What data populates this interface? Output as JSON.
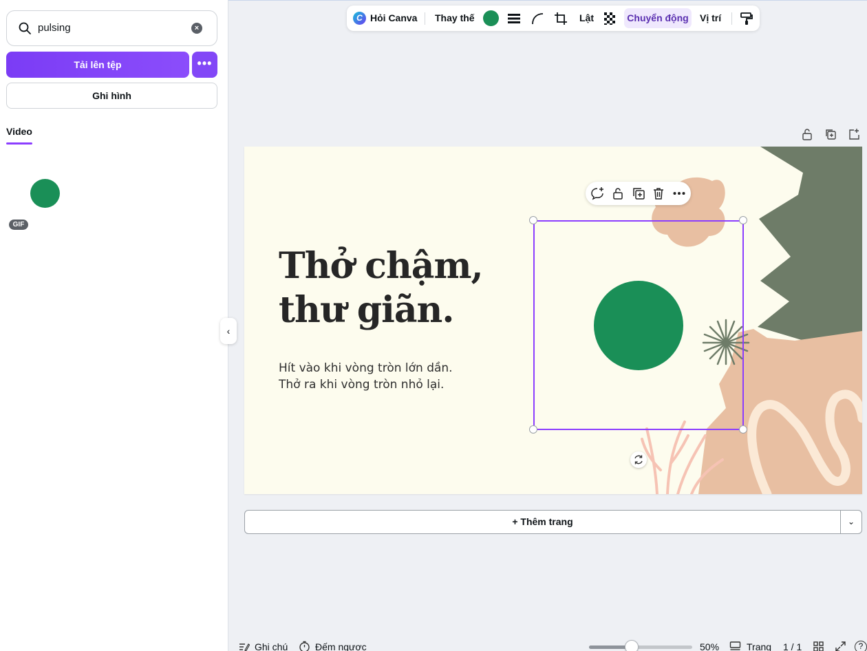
{
  "sidebar": {
    "search": {
      "value": "pulsing",
      "icon": "search-icon",
      "clear_icon": "clear-icon"
    },
    "upload_label": "Tải lên tệp",
    "more_label": "•••",
    "record_label": "Ghi hình",
    "tab_label": "Video",
    "result_badge": "GIF",
    "collapse_label": "‹"
  },
  "toolbar": {
    "ask_canva": "Hỏi Canva",
    "replace": "Thay thế",
    "flip": "Lật",
    "animate": "Chuyển động",
    "position": "Vị trí",
    "color": "#1a8f57"
  },
  "canvas": {
    "title_line1": "Thở chậm,",
    "title_line2": "thư giãn.",
    "body_line1": "Hít vào khi vòng tròn lớn dần.",
    "body_line2": "Thở ra khi vòng tròn nhỏ lại.",
    "circle_color": "#1a8f57",
    "background": "#fdfcee"
  },
  "add_page_label": "+ Thêm trang",
  "add_page_dd": "⌄",
  "bottom_bar": {
    "notes": "Ghi chú",
    "timer": "Đếm ngược",
    "zoom": "50%",
    "pages_label": "Trang",
    "page_count": "1 / 1",
    "help": "?",
    "zoom_level": 0.5
  }
}
